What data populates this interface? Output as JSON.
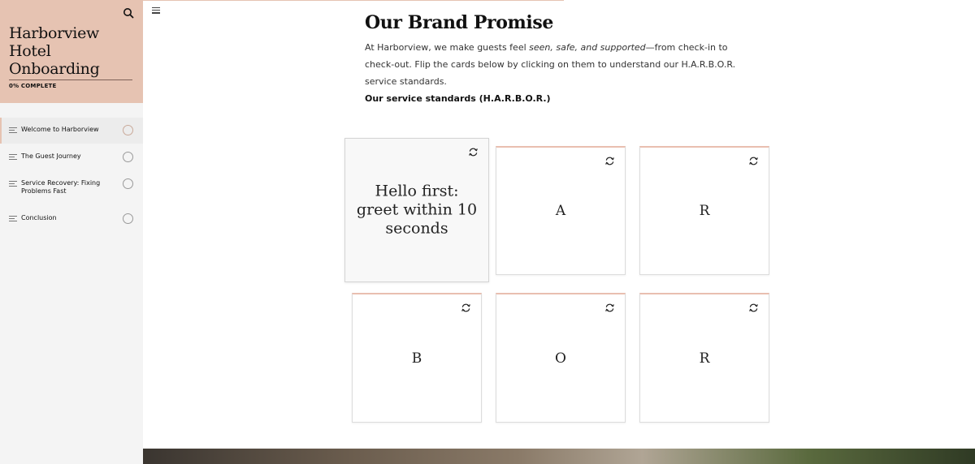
{
  "sidebar": {
    "title": "Harborview Hotel Onboarding",
    "progress_text": "0% COMPLETE",
    "progress_value": 0,
    "items": [
      {
        "label": "Welcome to Harborview",
        "active": true
      },
      {
        "label": "The Guest Journey",
        "active": false
      },
      {
        "label": "Service Recovery: Fixing Problems Fast",
        "active": false
      },
      {
        "label": "Conclusion",
        "active": false
      }
    ]
  },
  "main": {
    "heading": "Our Brand Promise",
    "intro": {
      "before": "At Harborview, we make guests feel ",
      "emphasis": "seen, safe, and supported",
      "after": "—from check-in to check-out. Flip the cards below by clicking on them to understand our H.A.R.B.O.R. service standards."
    },
    "subheading": "Our service standards (H.A.R.B.O.R.)",
    "cards": [
      {
        "front": "H",
        "back": "Hello first: greet within 10 seconds",
        "flipped": true
      },
      {
        "front": "A",
        "flipped": false
      },
      {
        "front": "R",
        "flipped": false
      },
      {
        "front": "B",
        "flipped": false
      },
      {
        "front": "O",
        "flipped": false
      },
      {
        "front": "R",
        "flipped": false
      }
    ]
  },
  "icons": {
    "search": "search-icon",
    "menu": "hamburger-menu-icon",
    "flip": "flip-card-icon",
    "lesson": "lesson-lines-icon",
    "status": "status-circle-icon"
  },
  "colors": {
    "sidebar_header": "#e6c3b2",
    "card_accent": "#e9bfb0",
    "sidebar_bg": "#f4f4f4"
  }
}
